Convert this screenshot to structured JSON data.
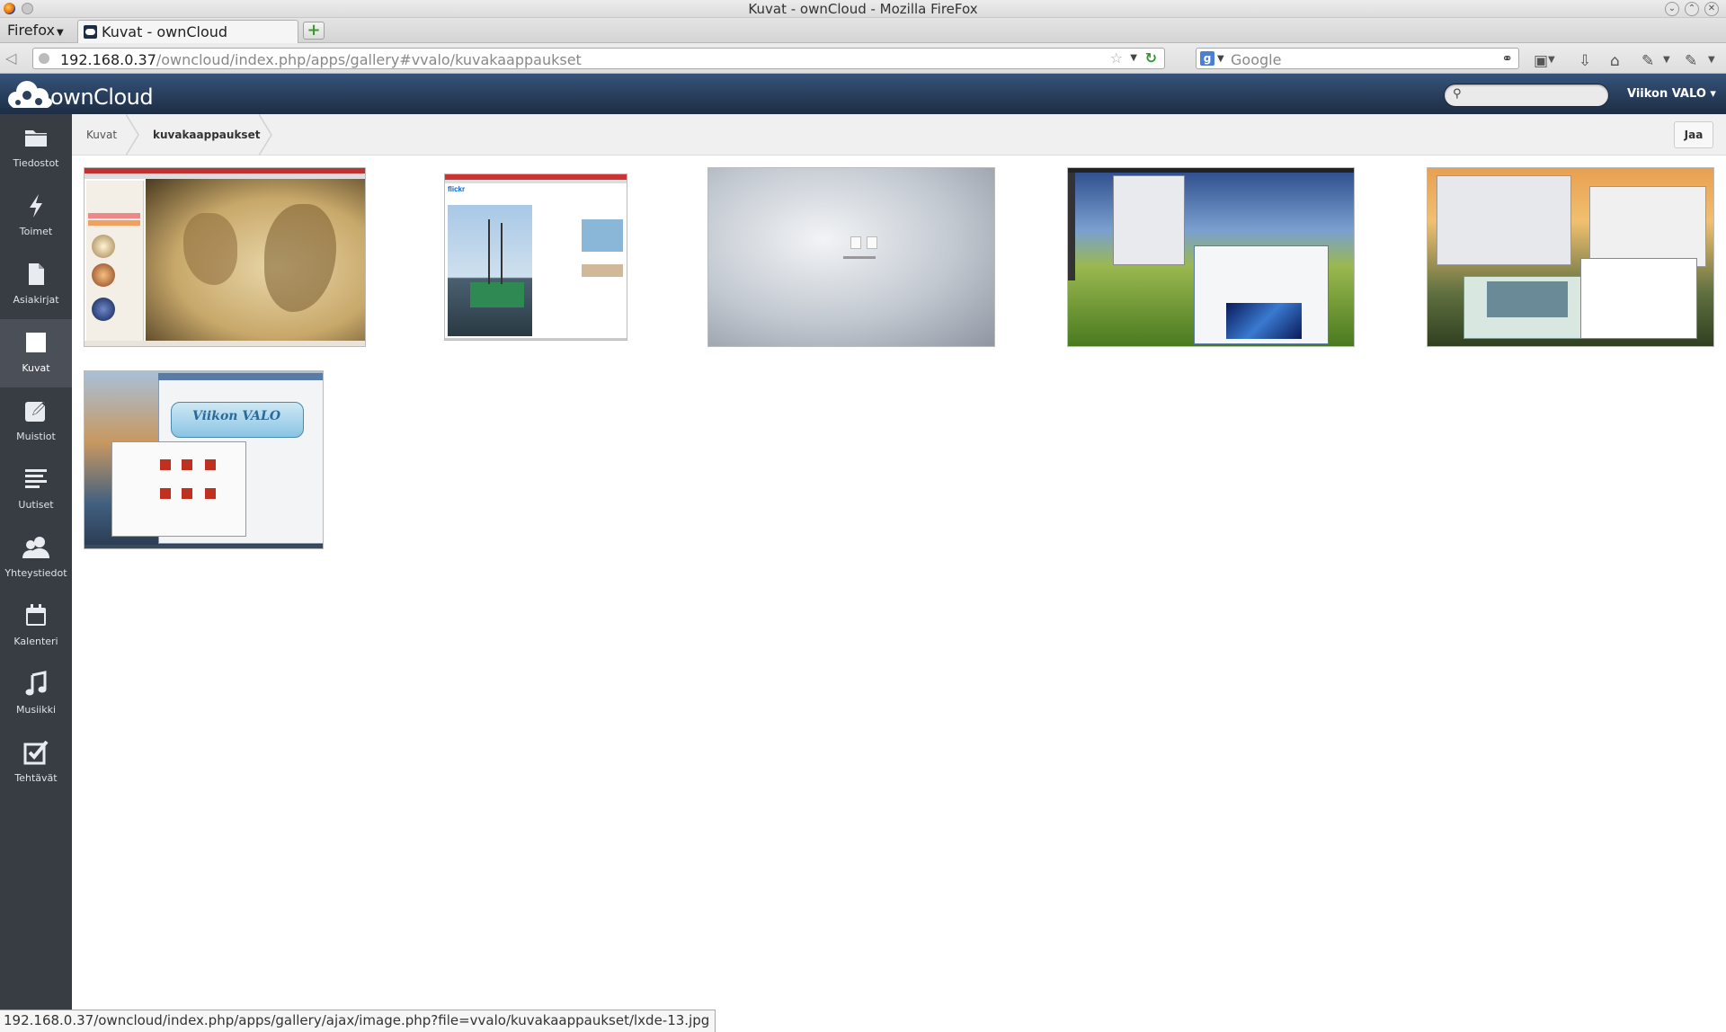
{
  "browser": {
    "window_title": "Kuvat - ownCloud - Mozilla FireFox",
    "menu_label": "Firefox",
    "tab_title": "Kuvat - ownCloud",
    "url_host": "192.168.0.37",
    "url_path": "/owncloud/index.php/apps/gallery#vvalo/kuvakaappaukset",
    "search_engine_placeholder": "Google",
    "status_url": "192.168.0.37/owncloud/index.php/apps/gallery/ajax/image.php?file=vvalo/kuvakaappaukset/lxde-13.jpg"
  },
  "header": {
    "logo_text": "ownCloud",
    "user_label": "Viikon VALO ▾"
  },
  "sidebar": {
    "items": [
      {
        "label": "Tiedostot",
        "icon": "folder-icon"
      },
      {
        "label": "Toimet",
        "icon": "lightning-icon"
      },
      {
        "label": "Asiakirjat",
        "icon": "document-icon"
      },
      {
        "label": "Kuvat",
        "icon": "picture-icon",
        "active": true
      },
      {
        "label": "Muistiot",
        "icon": "note-pencil-icon"
      },
      {
        "label": "Uutiset",
        "icon": "news-lines-icon"
      },
      {
        "label": "Yhteystiedot",
        "icon": "contacts-icon"
      },
      {
        "label": "Kalenteri",
        "icon": "calendar-icon"
      },
      {
        "label": "Musiikki",
        "icon": "music-note-icon"
      },
      {
        "label": "Tehtävät",
        "icon": "checkbox-icon"
      }
    ]
  },
  "breadcrumb": {
    "root": "Kuvat",
    "current": "kuvakaappaukset"
  },
  "share_button": "Jaa",
  "gallery": {
    "images": [
      {
        "name": "world-map-screenshot"
      },
      {
        "name": "flickr-ship-screenshot"
      },
      {
        "name": "grey-desktop-screenshot"
      },
      {
        "name": "grass-desktop-screenshot"
      },
      {
        "name": "sunset-desktop-screenshot"
      },
      {
        "name": "lxde-13-screenshot",
        "label": "Viikon VALO"
      }
    ]
  }
}
